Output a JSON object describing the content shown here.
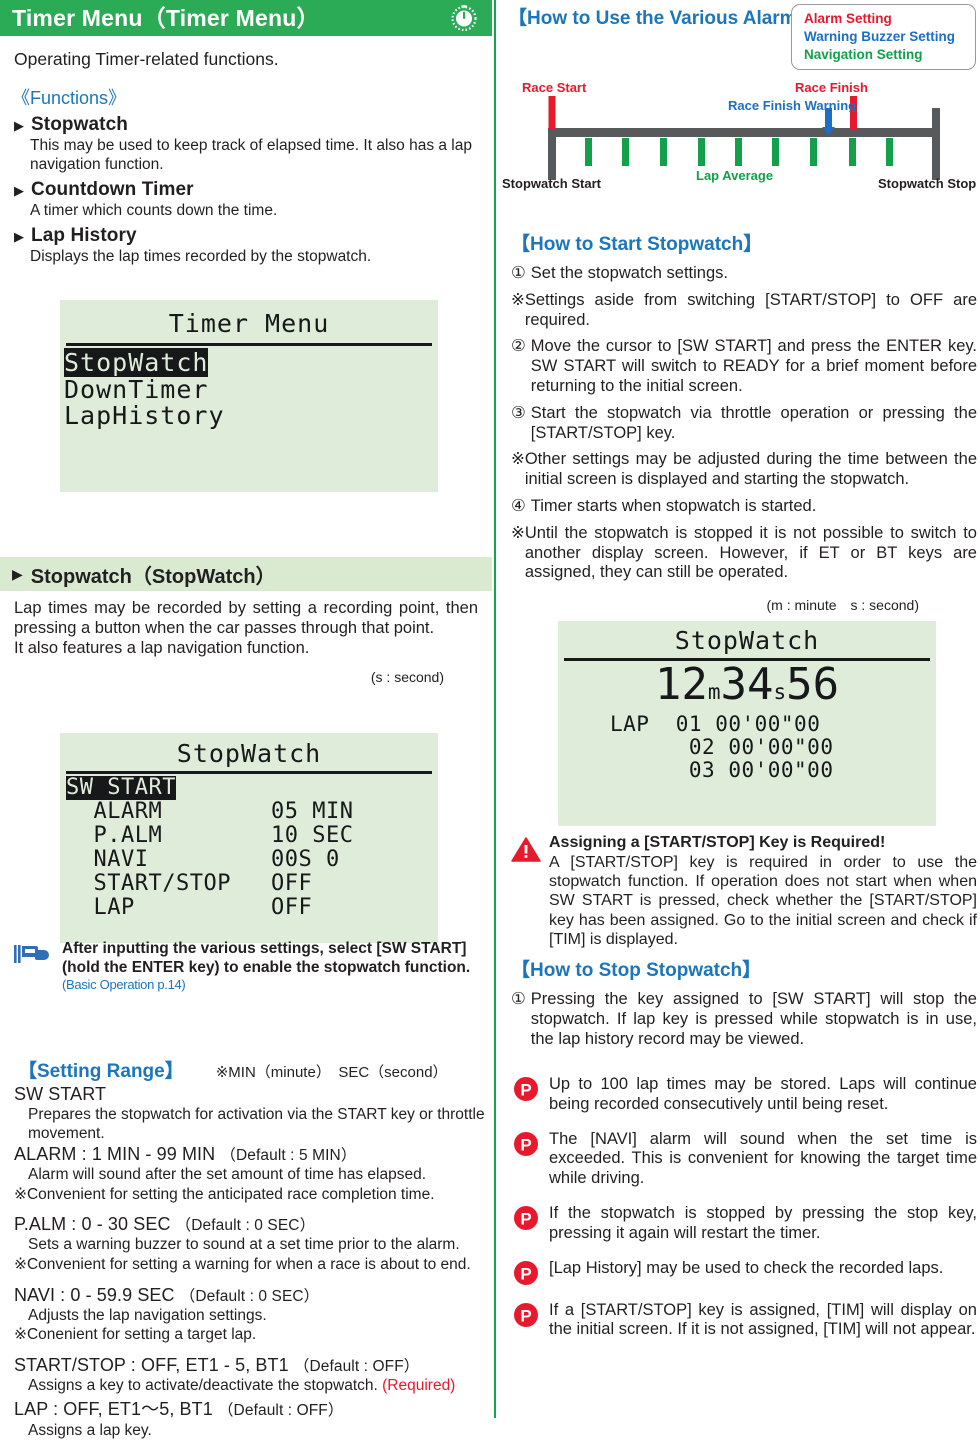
{
  "header": {
    "title": "Timer Menu（Timer Menu）",
    "icon": "stopwatch-icon"
  },
  "left": {
    "lead": "Operating Timer-related functions.",
    "functions_heading": "《Functions》",
    "functions": [
      {
        "name": "Stopwatch",
        "desc": "This may be used to keep track of elapsed time. It also has a lap navigation function."
      },
      {
        "name": "Countdown Timer",
        "desc": "A timer which counts down the time."
      },
      {
        "name": "Lap History",
        "desc": "Displays the lap times recorded by the stopwatch."
      }
    ],
    "lcd_menu": {
      "title": "Timer Menu",
      "items": [
        "StopWatch",
        "DownTimer",
        "LapHistory"
      ],
      "selected_index": 0
    },
    "section_band": {
      "marker": "▶",
      "title": "Stopwatch（StopWatch）"
    },
    "section_para": "Lap times may be recorded by setting a recording point, then pressing a button when the car passes through that point.\nIt also features a lap navigation function.",
    "unit_note": "(s : second)",
    "lcd_settings": {
      "title": "StopWatch",
      "highlight_row": "SW START",
      "highlight_left": "SW",
      "highlight_right": "START",
      "rows": [
        {
          "label": "ALARM",
          "value": "05 MIN"
        },
        {
          "label": "P.ALM",
          "value": "10 SEC"
        },
        {
          "label": "NAVI",
          "value": "00S 0"
        },
        {
          "label": "START/STOP",
          "value": "OFF"
        },
        {
          "label": "LAP",
          "value": "OFF"
        }
      ]
    },
    "note": {
      "icon": "pointing-hand-icon",
      "text": "After inputting the various settings, select [SW START] (hold the ENTER key) to enable the stopwatch function.",
      "reference": "(Basic Operation p.14)"
    },
    "setting_range": {
      "heading": "【Setting Range】",
      "note": "※MIN（minute）　SEC（second）",
      "entries": [
        {
          "term": "SW START",
          "default": "",
          "sub": "Prepares the stopwatch for activation via the START key or throttle movement.",
          "kome": ""
        },
        {
          "term": "ALARM : 1 MIN - 99 MIN",
          "default": "（Default : 5 MIN）",
          "sub": "Alarm will sound after the set amount of time has elapsed.",
          "kome": "※Convenient for setting the anticipated race completion time."
        },
        {
          "term": "P.ALM : 0 - 30 SEC",
          "default": "（Default : 0 SEC）",
          "sub": "Sets a warning buzzer to sound at a set time prior to the alarm.",
          "kome": "※Convenient for setting a warning for when a race is about to end."
        },
        {
          "term": "NAVI : 0 - 59.9 SEC",
          "default": "（Default : 0 SEC）",
          "sub": "Adjusts the lap navigation settings.",
          "kome": "※Conenient for setting a target lap."
        },
        {
          "term": "START/STOP : OFF, ET1 - 5, BT1",
          "default": "（Default : OFF）",
          "sub": "Assigns a key to activate/deactivate the stopwatch.",
          "sub_suffix": "(Required)",
          "kome": ""
        },
        {
          "term": "LAP : OFF, ET1〜5, BT1",
          "default": "（Default : OFF）",
          "sub": "Assigns a lap key.",
          "kome": ""
        }
      ]
    }
  },
  "right": {
    "alarms_heading": "【How to Use the Various Alarms】",
    "legend": [
      {
        "label": "Alarm Setting",
        "color": "#e8192c"
      },
      {
        "label": "Warning Buzzer Setting",
        "color": "#1b6fc4"
      },
      {
        "label": "Navigation Setting",
        "color": "#14a04a"
      }
    ],
    "timeline": {
      "labels": {
        "race_start": "Race Start",
        "race_finish": "Race Finish",
        "race_finish_warning": "Race Finish Warning",
        "stopwatch_start": "Stopwatch Start",
        "stopwatch_stop": "Stopwatch Stop",
        "lap_average": "Lap Average"
      }
    },
    "start_heading": "【How to Start Stopwatch】",
    "start_steps": [
      {
        "no": "①",
        "text": "Set the stopwatch settings."
      },
      {
        "no": "※",
        "text": "Settings aside from switching [START/STOP] to OFF are required."
      },
      {
        "no": "②",
        "text": "Move the cursor to [SW START] and press the ENTER key. SW START will switch to READY for a brief moment before returning to the initial screen."
      },
      {
        "no": "③",
        "text": "Start the stopwatch via throttle operation or pressing the [START/STOP] key."
      },
      {
        "no": "※",
        "text": "Other settings may be adjusted during the time between the initial screen is displayed and starting the stopwatch."
      },
      {
        "no": "④",
        "text": "Timer starts when stopwatch is started."
      },
      {
        "no": "※",
        "text": "Until the stopwatch is stopped it is not possible to switch to another display screen. However, if ET or BT keys are assigned, they can still be operated."
      }
    ],
    "unit_note": "(m : minute　s : second)",
    "lcd_running": {
      "title": "StopWatch",
      "minutes": "12",
      "minutes_unit": "m",
      "seconds": "34",
      "seconds_unit": "s",
      "hundredths": "56",
      "lap_label": "LAP",
      "laps": [
        {
          "no": "01",
          "time": "00'00\"00"
        },
        {
          "no": "02",
          "time": "00'00\"00"
        },
        {
          "no": "03",
          "time": "00'00\"00"
        }
      ]
    },
    "warning": {
      "icon": "warning-triangle-icon",
      "title": "Assigning a [START/STOP] Key is Required!",
      "text": "A [START/STOP] key is required in order to use the stopwatch function. If operation does not start when when SW START is pressed, check whether the [START/STOP] key has been assigned. Go to the initial screen and check if [TIM] is displayed."
    },
    "stop_heading": "【How to Stop Stopwatch】",
    "stop_steps": [
      {
        "no": "①",
        "text": "Pressing the key assigned to [SW START] will stop the stopwatch. If lap key is pressed while stopwatch is in use, the lap history record may be viewed."
      }
    ],
    "point_bullets": [
      "Up to 100 lap times may be stored. Laps will continue being recorded consecutively until being reset.",
      "The [NAVI] alarm will sound when the set time is exceeded. This is convenient for knowing the target time while driving.",
      "If the stopwatch is stopped by pressing the stop key, pressing it again will restart the timer.",
      "[Lap History] may be used to check the recorded laps.",
      "If a [START/STOP] key is assigned, [TIM] will display on the initial screen. If it is not assigned, [TIM] will not appear."
    ]
  },
  "colors": {
    "header_green": "#2bab56",
    "band_green": "#d9ead0",
    "lcd_green": "#dfecd9",
    "link_blue": "#1b76bc",
    "alarm_red": "#e8192c",
    "buzzer_blue": "#1b6fc4",
    "navi_green": "#14a04a",
    "rail_gray": "#58595b"
  }
}
